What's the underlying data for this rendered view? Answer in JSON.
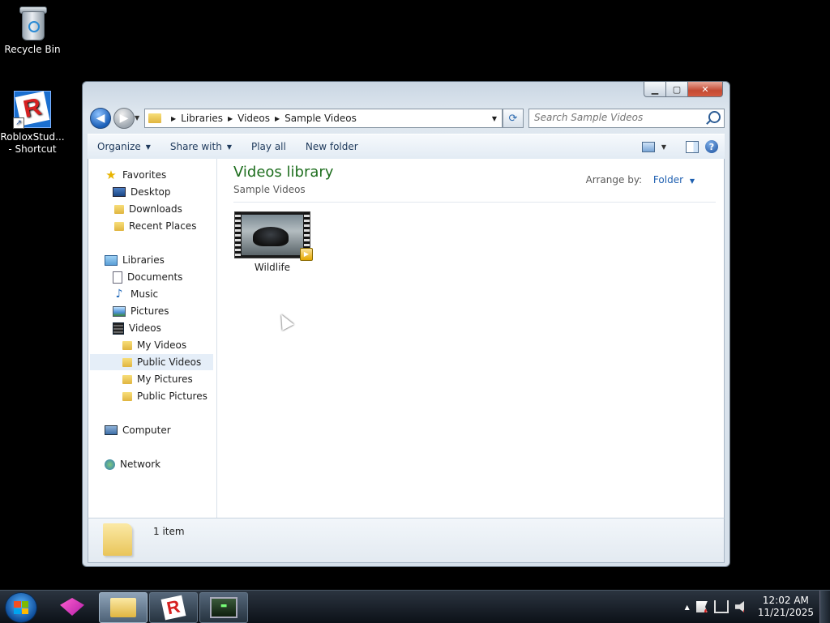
{
  "desktop": {
    "icons": [
      {
        "label": "Recycle Bin"
      },
      {
        "label": "RobloxStud... - Shortcut"
      }
    ]
  },
  "window": {
    "controls": {
      "minimize": "▁",
      "maximize": "▢",
      "close": "✕"
    },
    "address": {
      "breadcrumbs": [
        "Libraries",
        "Videos",
        "Sample Videos"
      ]
    },
    "search": {
      "placeholder": "Search Sample Videos"
    },
    "toolbar": {
      "organize": "Organize",
      "share_with": "Share with",
      "play_all": "Play all",
      "new_folder": "New folder"
    },
    "nav": {
      "favorites": "Favorites",
      "desktop": "Desktop",
      "downloads": "Downloads",
      "recent_places": "Recent Places",
      "libraries": "Libraries",
      "documents": "Documents",
      "music": "Music",
      "pictures": "Pictures",
      "videos": "Videos",
      "my_videos": "My Videos",
      "public_videos": "Public Videos",
      "my_pictures": "My Pictures",
      "public_pictures": "Public Pictures",
      "computer": "Computer",
      "network": "Network"
    },
    "main": {
      "title": "Videos library",
      "subtitle": "Sample Videos",
      "arrange_label": "Arrange by:",
      "arrange_value": "Folder",
      "files": [
        {
          "name": "Wildlife"
        }
      ]
    },
    "details": {
      "count": "1 item"
    }
  },
  "taskbar": {
    "clock_time": "12:02 AM",
    "clock_date": "11/21/2025"
  }
}
